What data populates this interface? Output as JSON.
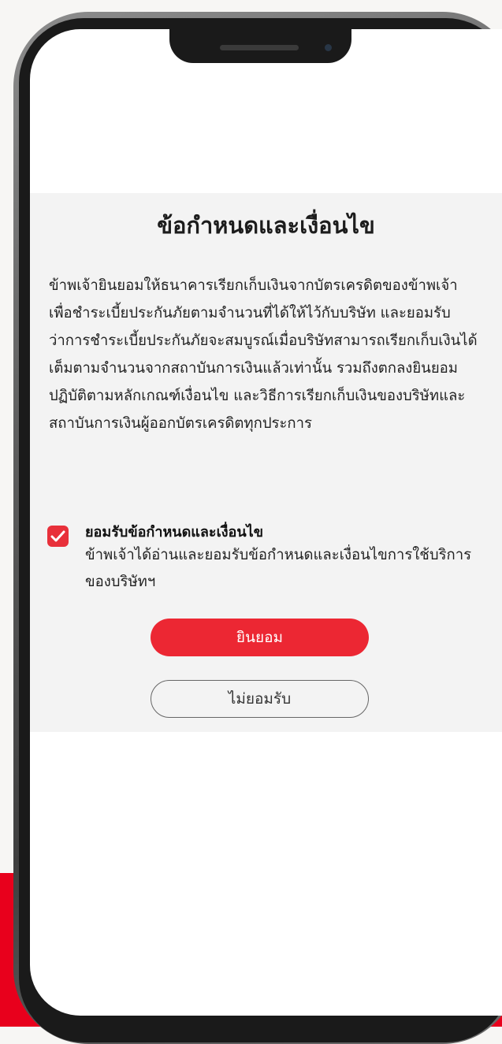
{
  "terms": {
    "title": "ข้อกำหนดและเงื่อนไข",
    "body": "ข้าพเจ้ายินยอมให้ธนาคารเรียกเก็บเงินจากบัตรเครดิตของข้าพเจ้า เพื่อชำระเบี้ยประกันภัยตามจำนวนที่ได้ให้ไว้กับบริษัท และยอมรับว่าการชำระเบี้ยประกันภัยจะสมบูรณ์เมื่อบริษัทสามารถเรียกเก็บเงินได้เต็มตามจำนวนจากสถาบันการเงินแล้วเท่านั้น รวมถึงตกลงยินยอมปฏิบัติตามหลักเกณฑ์เงื่อนไข และวิธีการเรียกเก็บเงินของบริษัทและสถาบันการเงินผู้ออกบัตรเครดิตทุกประการ"
  },
  "agreement": {
    "checked": true,
    "title": "ยอมรับข้อกำหนดและเงื่อนไข",
    "description": "ข้าพเจ้าได้อ่านและยอมรับข้อกำหนดและเงื่อนไขการใช้บริการของบริษัทฯ"
  },
  "buttons": {
    "accept": "ยินยอม",
    "decline": "ไม่ยอมรับ"
  },
  "colors": {
    "accent": "#ec2733",
    "background_band": "#e8001c"
  }
}
